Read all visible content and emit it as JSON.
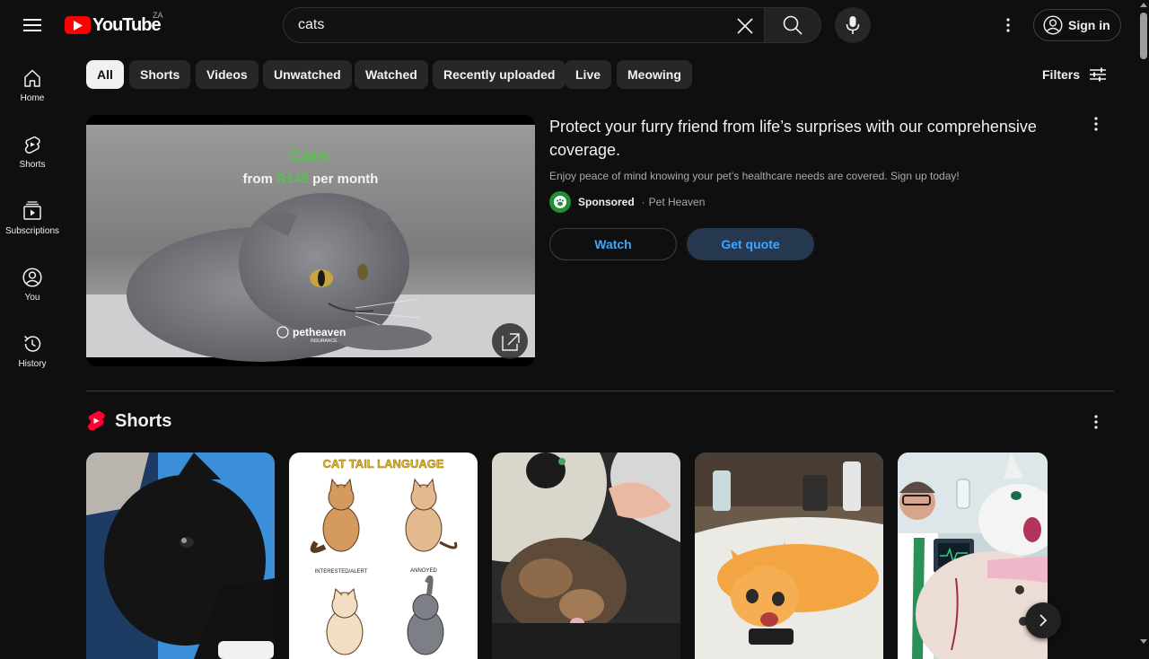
{
  "header": {
    "logo_text": "YouTube",
    "country_code": "ZA",
    "search_value": "cats",
    "signin_label": "Sign in"
  },
  "sidebar": {
    "items": [
      {
        "label": "Home",
        "icon": "home-icon"
      },
      {
        "label": "Shorts",
        "icon": "shorts-icon"
      },
      {
        "label": "Subscriptions",
        "icon": "subscriptions-icon"
      },
      {
        "label": "You",
        "icon": "you-icon"
      },
      {
        "label": "History",
        "icon": "history-icon"
      }
    ]
  },
  "chips": [
    {
      "label": "All",
      "active": true
    },
    {
      "label": "Shorts"
    },
    {
      "label": "Videos"
    },
    {
      "label": "Unwatched"
    },
    {
      "label": "Watched"
    },
    {
      "label": "Recently uploaded"
    },
    {
      "label": "Live"
    },
    {
      "label": "Meowing"
    }
  ],
  "filters_label": "Filters",
  "ad": {
    "thumb_headline": "Cats:",
    "thumb_sub_prefix": "from",
    "thumb_price": "R145",
    "thumb_sub_suffix": "per month",
    "thumb_brand": "petheaven",
    "thumb_brand_sub": "INSURANCE",
    "title": "Protect your furry friend from life’s surprises with our comprehensive coverage.",
    "description": "Enjoy peace of mind knowing your pet’s healthcare needs are covered. Sign up today!",
    "sponsored_label": "Sponsored",
    "advertiser": "Pet Heaven",
    "watch_label": "Watch",
    "quote_label": "Get quote"
  },
  "shorts": {
    "heading": "Shorts",
    "items": [
      {
        "name": "short-black-cat"
      },
      {
        "name": "short-cat-tail-language",
        "title": "CAT TAIL LANGUAGE",
        "labels": [
          "INTERESTED/ALERT",
          "ANNOYED"
        ]
      },
      {
        "name": "short-kitten"
      },
      {
        "name": "short-orange-cat"
      },
      {
        "name": "short-white-cat-doctor"
      }
    ]
  },
  "colors": {
    "background": "#0f0f0f",
    "accent_red": "#ff0000",
    "link_blue": "#3ea6ff",
    "chip_bg": "#272727"
  }
}
